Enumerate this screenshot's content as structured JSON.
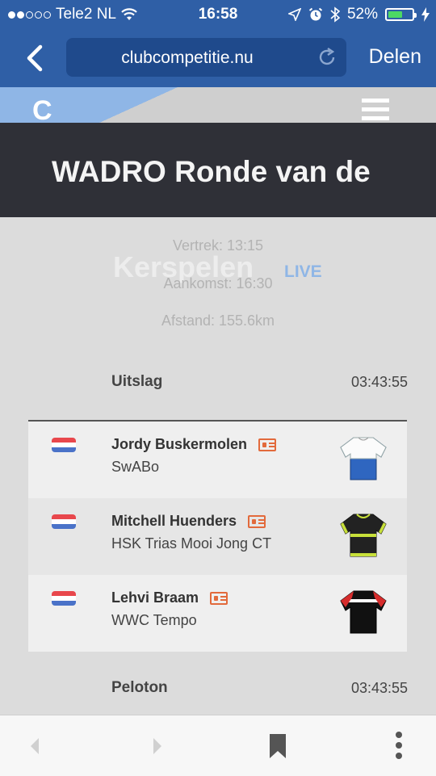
{
  "status_bar": {
    "carrier": "Tele2 NL",
    "time": "16:58",
    "battery": "52%",
    "battery_level": 0.52,
    "icons": [
      "signal-dots-icon",
      "wifi-icon",
      "location-icon",
      "alarm-icon",
      "bluetooth-icon",
      "battery-icon",
      "charging-icon"
    ]
  },
  "browser": {
    "url": "clubcompetitie.nu",
    "share_label": "Delen"
  },
  "site": {
    "logo_letter": "C"
  },
  "race": {
    "title": "WADRO Ronde van de",
    "subtitle": "Kerspelen",
    "live_badge": "LIVE",
    "departure": "Vertrek: 13:15",
    "arrival": "Aankomst: 16:30",
    "distance": "Afstand: 155.6km"
  },
  "results": {
    "header": "Uitslag",
    "time": "03:43:55",
    "riders": [
      {
        "name": "Jordy Buskermolen",
        "team": "SwABo",
        "jersey_colors": [
          "#ffffff",
          "#2f66c0"
        ]
      },
      {
        "name": "Mitchell Huenders",
        "team": "HSK Trias Mooi Jong CT",
        "jersey_colors": [
          "#222222",
          "#c8e03a"
        ]
      },
      {
        "name": "Lehvi Braam",
        "team": "WWC Tempo",
        "jersey_colors": [
          "#111111",
          "#d62c2c"
        ]
      }
    ]
  },
  "peloton": {
    "header": "Peloton",
    "time": "03:43:55"
  },
  "colors": {
    "brand_blue": "#2f5fa6",
    "title_bar": "#2f3037",
    "live": "#8fb6e6",
    "card_orange": "#e26a3c",
    "flag_red": "#e8474c",
    "flag_blue": "#4a72c8"
  }
}
